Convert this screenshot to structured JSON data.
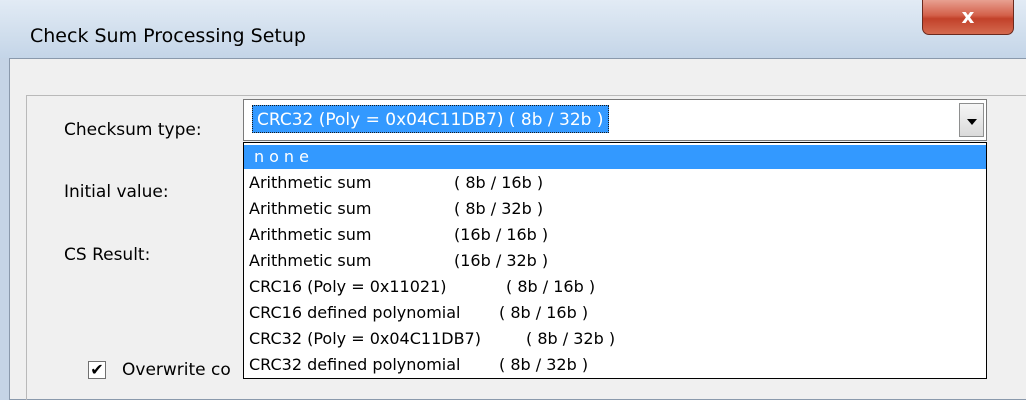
{
  "window": {
    "title": "Check Sum Processing Setup",
    "close_label": "x"
  },
  "labels": {
    "checksum_type": "Checksum type:",
    "initial_value": "Initial value:",
    "cs_result": "CS Result:",
    "overwrite": "Overwrite co"
  },
  "combo": {
    "selected": "CRC32 (Poly = 0x04C11DB7) ( 8b / 32b )"
  },
  "options": [
    {
      "name": "none",
      "bits": ""
    },
    {
      "name": "Arithmetic sum",
      "bits": "( 8b / 16b )"
    },
    {
      "name": "Arithmetic sum",
      "bits": "( 8b / 32b )"
    },
    {
      "name": "Arithmetic sum",
      "bits": "(16b / 16b )"
    },
    {
      "name": "Arithmetic sum",
      "bits": "(16b / 32b )"
    },
    {
      "name": "CRC16 (Poly = 0x11021)",
      "bits": "( 8b / 16b )"
    },
    {
      "name": "CRC16 defined polynomial",
      "bits": "( 8b / 16b )"
    },
    {
      "name": "CRC32 (Poly = 0x04C11DB7)",
      "bits": "( 8b / 32b )"
    },
    {
      "name": "CRC32 defined polynomial",
      "bits": "( 8b / 32b )"
    }
  ],
  "checkbox": {
    "checked_mark": "✔"
  }
}
